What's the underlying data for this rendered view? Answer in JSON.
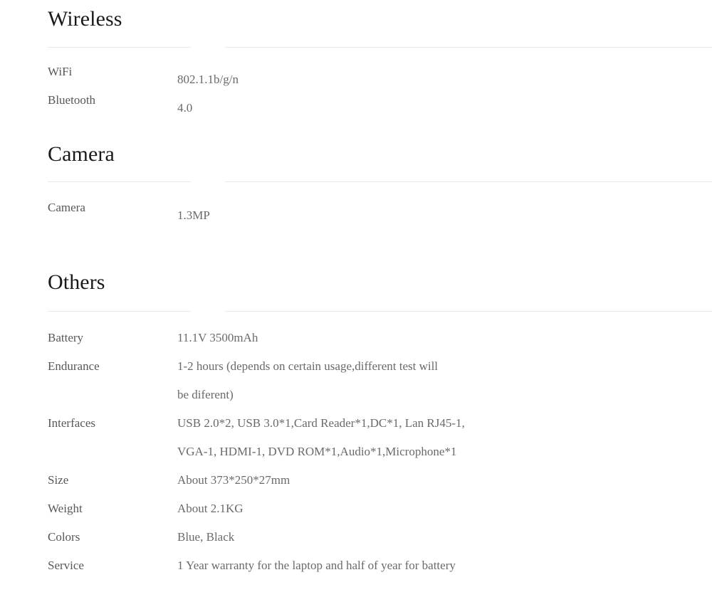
{
  "document": {
    "type": "product-specification-sheet",
    "colors": {
      "background": "#ffffff",
      "heading_text": "#1a1a1a",
      "label_text": "#585858",
      "value_text": "#6a6a6a",
      "divider": "#e9e9e9"
    }
  },
  "sections": [
    {
      "id": "wireless",
      "heading": "Wireless",
      "rows": [
        {
          "label": "WiFi",
          "value": "802.1.1b/g/n"
        },
        {
          "label": "Bluetooth",
          "value": "4.0"
        }
      ]
    },
    {
      "id": "camera",
      "heading": "Camera",
      "rows": [
        {
          "label": "Camera",
          "value": "1.3MP"
        }
      ]
    },
    {
      "id": "others",
      "heading": "Others",
      "rows": [
        {
          "label": "Battery",
          "value": "11.1V 3500mAh"
        },
        {
          "label": "Endurance",
          "value": "1-2 hours (depends on certain usage,different test will\nbe diferent)"
        },
        {
          "label": "Interfaces",
          "value": "USB 2.0*2, USB 3.0*1,Card Reader*1,DC*1, Lan RJ45-1,\nVGA-1, HDMI-1, DVD ROM*1,Audio*1,Microphone*1"
        },
        {
          "label": "Size",
          "value": "About 373*250*27mm"
        },
        {
          "label": "Weight",
          "value": "About 2.1KG"
        },
        {
          "label": "Colors",
          "value": "Blue, Black"
        },
        {
          "label": "Service",
          "value": "1 Year warranty for the laptop and half of year for battery"
        }
      ]
    }
  ]
}
